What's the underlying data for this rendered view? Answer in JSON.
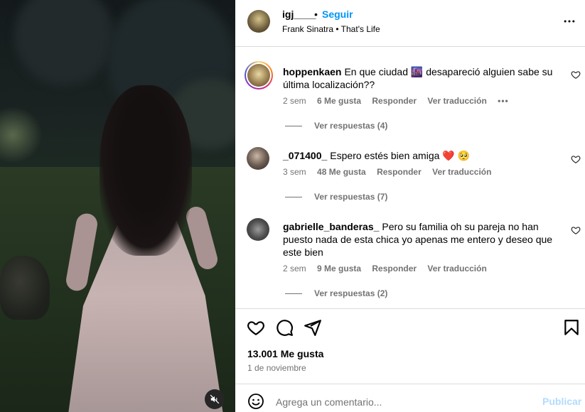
{
  "header": {
    "username": "igj____",
    "separator": "•",
    "follow_label": "Seguir",
    "audio": "Frank Sinatra • That's Life",
    "more_icon": "more-horizontal-icon"
  },
  "comments": [
    {
      "username": "hoppenkaen",
      "text": "En que ciudad 🌆 desapareció alguien sabe su última localización??",
      "time": "2 sem",
      "likes": "6 Me gusta",
      "reply_label": "Responder",
      "translate_label": "Ver traducción",
      "options": "•••",
      "replies_label": "Ver respuestas (4)"
    },
    {
      "username": "_071400_",
      "text": "Espero estés bien amiga ❤️ 🥺",
      "time": "3 sem",
      "likes": "48 Me gusta",
      "reply_label": "Responder",
      "translate_label": "Ver traducción",
      "replies_label": "Ver respuestas (7)"
    },
    {
      "username": "gabrielle_banderas_",
      "text": "Pero su familia oh su pareja no han puesto nada de esta chica yo apenas me entero y deseo que este bien",
      "time": "2 sem",
      "likes": "9 Me gusta",
      "reply_label": "Responder",
      "translate_label": "Ver traducción",
      "replies_label": "Ver respuestas (2)"
    }
  ],
  "footer": {
    "likes": "13.001 Me gusta",
    "date": "1 de noviembre",
    "comment_placeholder": "Agrega un comentario...",
    "post_label": "Publicar"
  },
  "colors": {
    "accent": "#0095f6",
    "muted": "#737373",
    "divider": "#dbdbdb"
  }
}
